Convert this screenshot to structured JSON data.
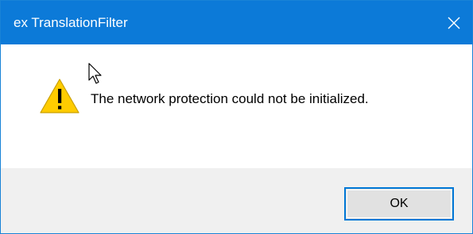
{
  "window": {
    "title": "ex TranslationFilter",
    "close_icon": "close-icon"
  },
  "content": {
    "icon": "warning-icon",
    "message": "The network protection could not be initialized."
  },
  "footer": {
    "ok_label": "OK"
  },
  "colors": {
    "titlebar": "#0c7ad8",
    "border": "#1883d7",
    "footer_bg": "#f0f0f0",
    "button_bg": "#e1e1e1",
    "button_focus_border": "#0078d7",
    "warning_fill": "#ffcc00"
  }
}
